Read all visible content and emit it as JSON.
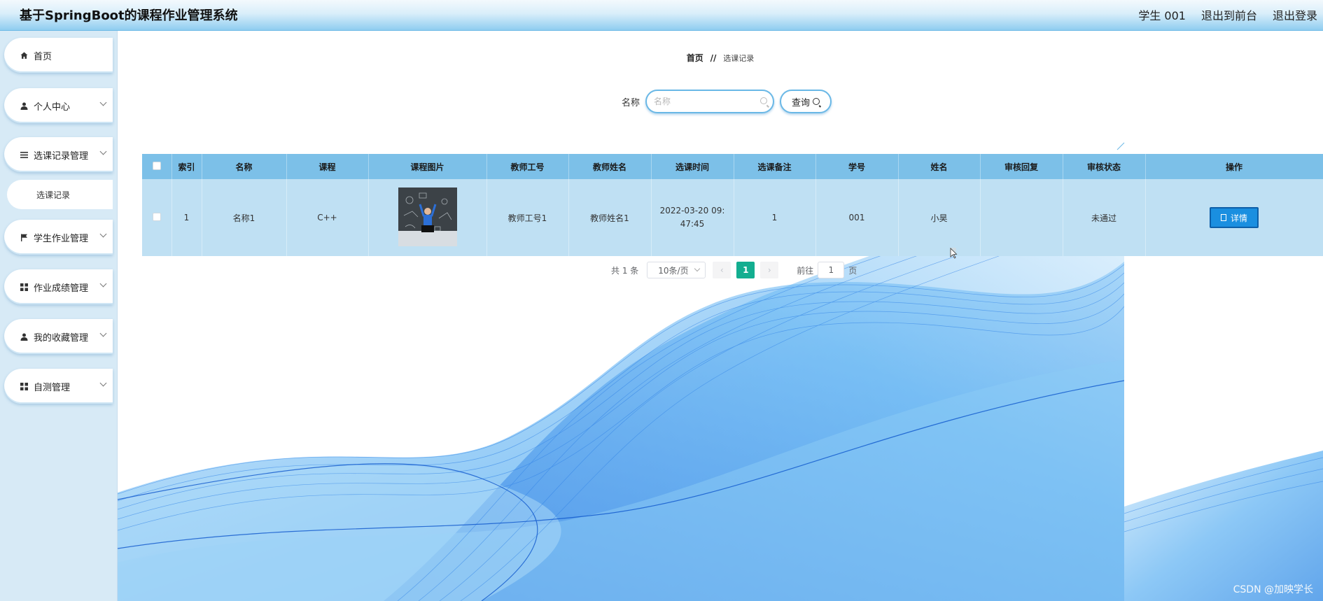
{
  "header": {
    "title": "基于SpringBoot的课程作业管理系统",
    "user": "学生 001",
    "back_to_front": "退出到前台",
    "logout": "退出登录"
  },
  "sidebar": {
    "items": [
      {
        "label": "首页",
        "icon": "home-icon",
        "expandable": false
      },
      {
        "label": "个人中心",
        "icon": "user-icon",
        "expandable": true
      },
      {
        "label": "选课记录管理",
        "icon": "list-icon",
        "expandable": true
      },
      {
        "label": "学生作业管理",
        "icon": "flag-icon",
        "expandable": true
      },
      {
        "label": "作业成绩管理",
        "icon": "grid-icon",
        "expandable": true
      },
      {
        "label": "我的收藏管理",
        "icon": "user-icon",
        "expandable": true
      },
      {
        "label": "自测管理",
        "icon": "grid-icon",
        "expandable": true
      }
    ],
    "subitem": "选课记录"
  },
  "breadcrumb": {
    "home": "首页",
    "separator": "//",
    "current": "选课记录"
  },
  "search": {
    "label": "名称",
    "placeholder": "名称",
    "button": "查询"
  },
  "table": {
    "headers": [
      "索引",
      "名称",
      "课程",
      "课程图片",
      "教师工号",
      "教师姓名",
      "选课时间",
      "选课备注",
      "学号",
      "姓名",
      "审核回复",
      "审核状态",
      "操作"
    ],
    "rows": [
      {
        "index": "1",
        "name": "名称1",
        "course": "C++",
        "teacher_id": "教师工号1",
        "teacher_name": "教师姓名1",
        "select_time": "2022-03-20 09:47:45",
        "remark": "1",
        "student_id": "001",
        "student_name": "小昊",
        "review_reply": "",
        "review_status": "未通过",
        "action": "详情"
      }
    ]
  },
  "pagination": {
    "total": "共 1 条",
    "page_size": "10条/页",
    "current_page": "1",
    "goto_label": "前往",
    "goto_value": "1",
    "page_suffix": "页"
  },
  "watermark": "CSDN @加映学长",
  "colors": {
    "header_blue": "#8fcdf0",
    "table_header": "#7cc0e8",
    "table_row": "#bfe0f3",
    "page_active": "#13ae90",
    "detail_button": "#1a8fe0"
  }
}
